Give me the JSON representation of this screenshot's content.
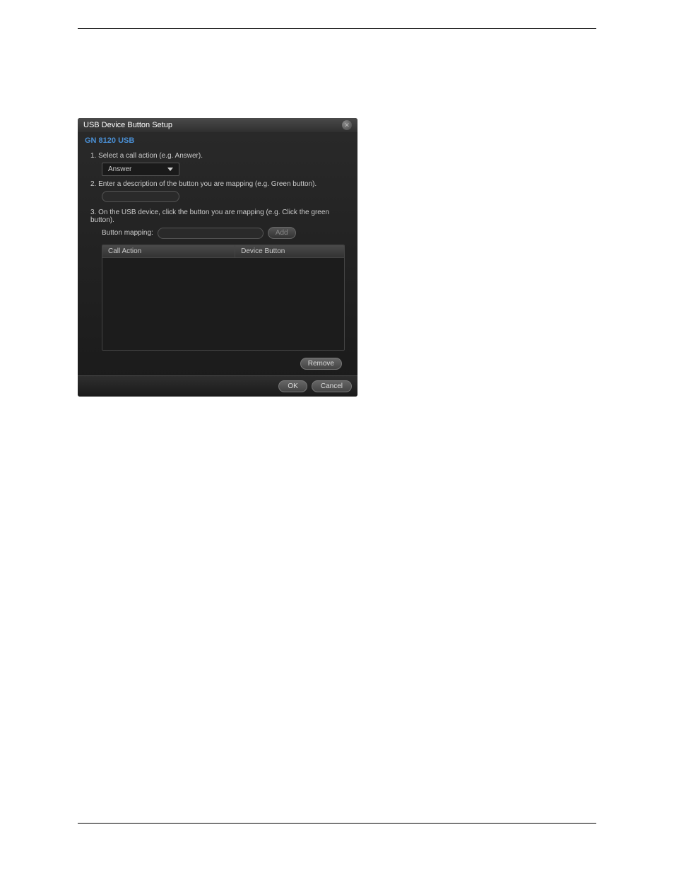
{
  "dialog": {
    "title": "USB Device Button Setup",
    "subtitle": "GN 8120 USB",
    "steps": {
      "step1": {
        "num": "1.",
        "text": "Select a call action (e.g. Answer).",
        "dropdown_value": "Answer"
      },
      "step2": {
        "num": "2.",
        "text": "Enter a description of the button you are mapping (e.g. Green button)."
      },
      "step3": {
        "num": "3.",
        "text": "On the USB device, click the button you are mapping (e.g. Click the green button)."
      }
    },
    "mapping": {
      "label": "Button mapping:",
      "add_label": "Add"
    },
    "table": {
      "col1": "Call Action",
      "col2": "Device Button"
    },
    "buttons": {
      "remove": "Remove",
      "ok": "OK",
      "cancel": "Cancel"
    }
  }
}
